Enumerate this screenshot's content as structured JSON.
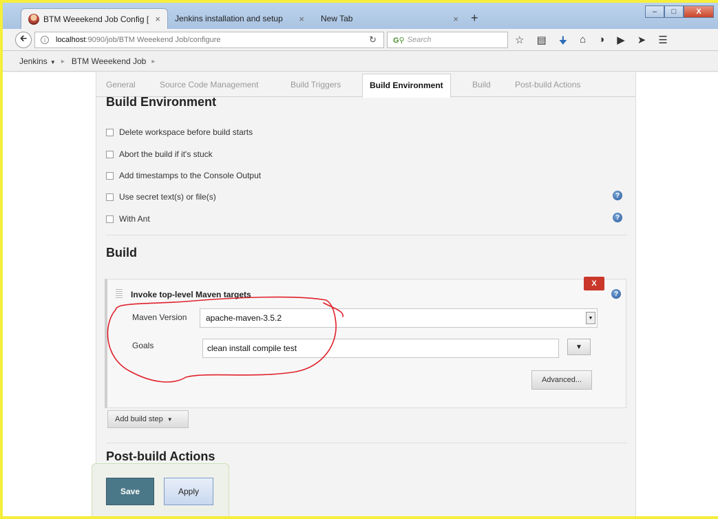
{
  "browser": {
    "tabs": [
      {
        "title": "BTM Weeekend Job Config [",
        "close": "×"
      },
      {
        "title": "Jenkins installation and setup",
        "close": "×"
      },
      {
        "title": "New Tab",
        "close": "×"
      }
    ],
    "new_tab": "+",
    "url_host": "localhost",
    "url_path": ":9090/job/BTM Weeekend Job/configure",
    "search_placeholder": "Search",
    "window_controls": {
      "min": "–",
      "max": "□",
      "close": "X"
    },
    "toolbar_icons": [
      "star-icon",
      "reading-list-icon",
      "download-icon",
      "home-icon",
      "pocket-icon",
      "youtube-icon",
      "extension-icon",
      "menu-icon"
    ]
  },
  "breadcrumb": {
    "root": "Jenkins",
    "job": "BTM Weeekend Job"
  },
  "config_tabs": [
    "General",
    "Source Code Management",
    "Build Triggers",
    "Build Environment",
    "Build",
    "Post-build Actions"
  ],
  "build_environment": {
    "title": "Build Environment",
    "options": [
      "Delete workspace before build starts",
      "Abort the build if it's stuck",
      "Add timestamps to the Console Output",
      "Use secret text(s) or file(s)",
      "With Ant"
    ]
  },
  "build": {
    "title": "Build",
    "step": {
      "title": "Invoke top-level Maven targets",
      "delete_label": "X",
      "maven_version_label": "Maven Version",
      "maven_version_value": "apache-maven-3.5.2",
      "goals_label": "Goals",
      "goals_value": "clean install compile test",
      "advanced_label": "Advanced..."
    },
    "add_step_label": "Add build step"
  },
  "post_build": {
    "title": "Post-build Actions"
  },
  "actions": {
    "save_label": "Save",
    "apply_label": "Apply"
  },
  "colors": {
    "frame": "#f5ee3a",
    "save": "#4b7888",
    "delete": "#c9382a",
    "annotation": "#e0202a"
  }
}
